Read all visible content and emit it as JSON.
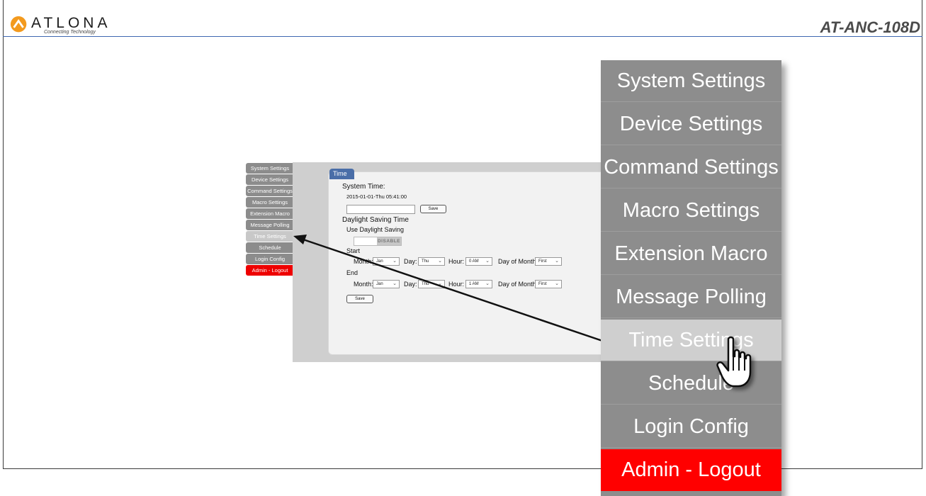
{
  "header": {
    "logo_text": "ATLONA",
    "logo_tagline": "Connecting Technology",
    "model": "AT-ANC-108D"
  },
  "small_menu": [
    {
      "label": "System Settings",
      "state": "normal"
    },
    {
      "label": "Device Settings",
      "state": "normal"
    },
    {
      "label": "Command Settings",
      "state": "normal"
    },
    {
      "label": "Macro Settings",
      "state": "normal"
    },
    {
      "label": "Extension Macro",
      "state": "normal"
    },
    {
      "label": "Message Polling",
      "state": "normal"
    },
    {
      "label": "Time Settings",
      "state": "active"
    },
    {
      "label": "Schedule",
      "state": "normal"
    },
    {
      "label": "Login Config",
      "state": "normal"
    },
    {
      "label": "Admin - Logout",
      "state": "logout"
    }
  ],
  "time_panel": {
    "tab_label": "Time",
    "system_time_label": "System Time:",
    "system_time_value": "2015-01-01-Thu 05:41:00",
    "time_input_value": "",
    "save_label": "Save",
    "dst_heading": "Daylight Saving Time",
    "use_dst_label": "Use Daylight Saving",
    "toggle_label": "DISABLE",
    "start_label": "Start",
    "end_label": "End",
    "month_label": "Month:",
    "day_label": "Day:",
    "hour_label": "Hour:",
    "dom_label": "Day of Month:",
    "start": {
      "month": "Jan",
      "day": "Thu",
      "hour": "0 AM",
      "dom": "First"
    },
    "end": {
      "month": "Jan",
      "day": "Thu",
      "hour": "1 AM",
      "dom": "First"
    },
    "save2_label": "Save"
  },
  "big_menu": [
    {
      "label": "System Settings",
      "state": "normal"
    },
    {
      "label": "Device Settings",
      "state": "normal"
    },
    {
      "label": "Command Settings",
      "state": "normal"
    },
    {
      "label": "Macro Settings",
      "state": "normal"
    },
    {
      "label": "Extension Macro",
      "state": "normal"
    },
    {
      "label": "Message Polling",
      "state": "normal"
    },
    {
      "label": "Time Settings",
      "state": "active"
    },
    {
      "label": "Schedule",
      "state": "normal"
    },
    {
      "label": "Login Config",
      "state": "normal"
    },
    {
      "label": "Admin - Logout",
      "state": "logout"
    }
  ],
  "colors": {
    "menu_gray": "#8d8d8d",
    "menu_active": "#cfcfcf",
    "logout_red": "#ff0000",
    "header_blue": "#3f67b1",
    "tab_blue": "#4a6ea8"
  },
  "icons": [
    "atlona-logo-icon",
    "arrow-pointer-icon",
    "hand-cursor-icon",
    "chevron-down-icon"
  ]
}
